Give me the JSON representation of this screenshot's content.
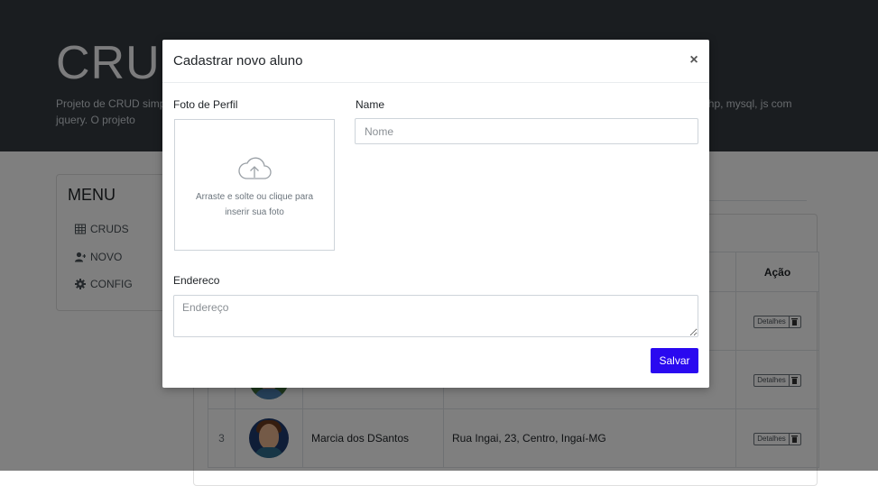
{
  "hero": {
    "title": "CRUD",
    "description": "Projeto de CRUD simples desenvolvido em php, mysql, js com jquery. O projeto consiste em um cadastro de alunos, desenvolvido em php, mysql, js com jquery. O projeto"
  },
  "sidebar": {
    "title": "MENU",
    "items": [
      {
        "label": "CRUDS",
        "icon": "table-icon"
      },
      {
        "label": "NOVO",
        "icon": "add-user-icon"
      },
      {
        "label": "CONFIG",
        "icon": "gear-icon"
      }
    ]
  },
  "table": {
    "action_header": "Ação",
    "rows": [
      {
        "num": "",
        "nome": "",
        "endereco": "",
        "detalhes": "Detalhes"
      },
      {
        "num": "",
        "nome": "",
        "endereco": "",
        "detalhes": "Detalhes"
      },
      {
        "num": "3",
        "nome": "Marcia dos DSantos",
        "endereco": "Rua Ingai, 23, Centro, Ingaí-MG",
        "detalhes": "Detalhes"
      }
    ]
  },
  "modal": {
    "title": "Cadastrar novo aluno",
    "close_symbol": "×",
    "photo_label": "Foto de Perfil",
    "dropzone_text": "Arraste e solte ou clique para inserir sua foto",
    "name_label": "Name",
    "name_placeholder": "Nome",
    "name_value": "",
    "address_label": "Endereco",
    "address_placeholder": "Endereço",
    "address_value": "",
    "save_label": "Salvar"
  },
  "colors": {
    "hero_bg": "#343a40",
    "save_button": "#2a09f0",
    "backdrop": "rgba(0,0,0,0.5)"
  }
}
